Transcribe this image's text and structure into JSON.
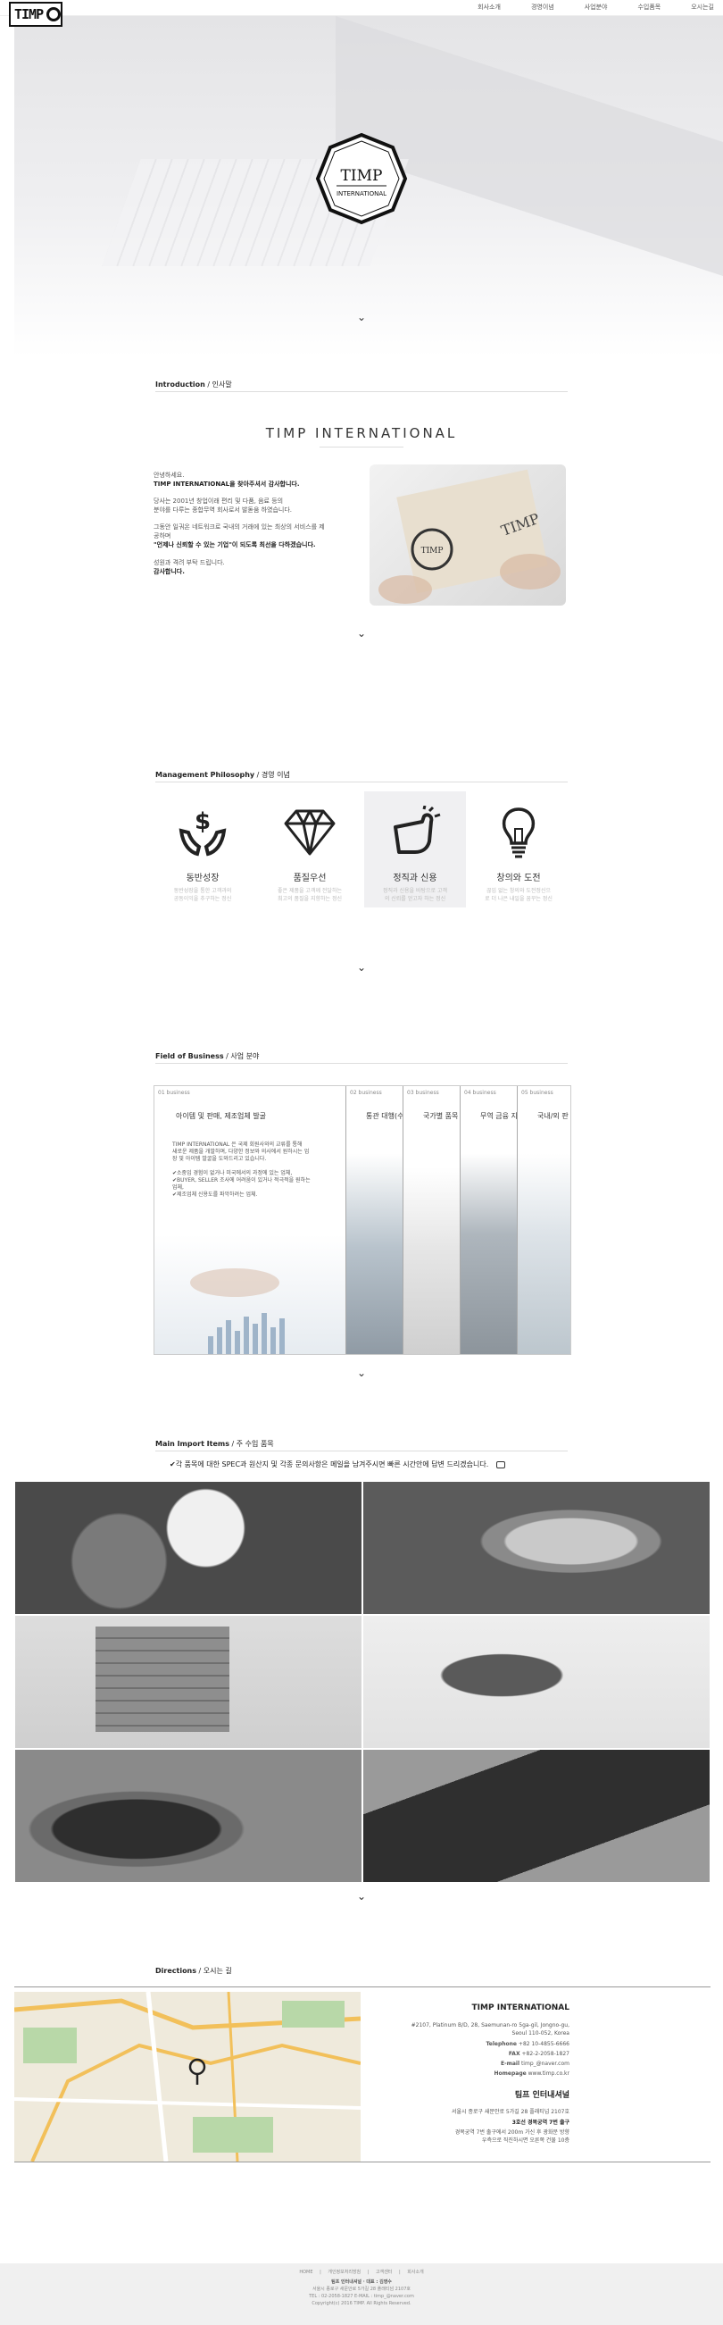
{
  "nav": {
    "logo": "TIMP",
    "items": [
      "회사소개",
      "경영이념",
      "사업분야",
      "수입품목",
      "오시는길"
    ]
  },
  "hero": {
    "emblem_title": "TIMP",
    "emblem_sub": "INTERNATIONAL"
  },
  "intro": {
    "title": "Introduction",
    "title_ko": " / 인사말",
    "brand": "TIMP INTERNATIONAL",
    "p1": "안녕하세요.",
    "p2": "TIMP INTERNATIONAL을 찾아주셔서 감사합니다.",
    "p3": "당사는 2001년 창업이래 편리 및 다품, 음료 등의",
    "p4": "분야를 다루는 종합무역 회사로서 발돋움 하였습니다.",
    "p5": "그동안 일궈온 네트워크로 국내의 거래에 있는 최상의 서비스를 제",
    "p6": "공하며",
    "p7": "\"언제나 신뢰할 수 있는 기업\"이 되도록 최선을 다하겠습니다.",
    "p8": "성원과 격려 부탁 드립니다.",
    "p9": "감사합니다."
  },
  "philosophy": {
    "title": "Management Philosophy",
    "title_ko": " / 경영 이념",
    "items": [
      {
        "name": "동반성장",
        "d1": "동반성장을 통한 고객과의",
        "d2": "공동이익을 추구하는 정신",
        "icon": "money-hands-icon"
      },
      {
        "name": "품질우선",
        "d1": "좋은 제품을 고객께 전달하는",
        "d2": "최고의 품질을 지향하는 정신",
        "icon": "diamond-icon"
      },
      {
        "name": "정직과 신용",
        "d1": "정직과 신용을 바탕으로 고객",
        "d2": "의 신뢰를 얻고자 하는 정신",
        "icon": "handshake-icon"
      },
      {
        "name": "창의와 도전",
        "d1": "끊임 없는 창의와 도전정신으",
        "d2": "로 더 나은 내일을 꿈꾸는 정신",
        "icon": "lightbulb-icon"
      }
    ]
  },
  "business": {
    "title": "Field of Business",
    "title_ko": " / 사업 분야",
    "panels": [
      {
        "num": "01 business",
        "head": "아이템 및 판매, 제조업체 발굴"
      },
      {
        "num": "02 business",
        "head": "통관 대행(수"
      },
      {
        "num": "03 business",
        "head": "국가별 품목"
      },
      {
        "num": "04 business",
        "head": "무역 금융 지"
      },
      {
        "num": "05 business",
        "head": "국내/외 판"
      }
    ],
    "b1": "TIMP INTERNATIONAL 은 국제 회원사와의 교류를 통해",
    "b2": "새로운 제품을 개발하며, 다양한 정보와 의사에서 원하시는 업",
    "b3": "장 및 아이템 발굴을 도와드리고 있습니다.",
    "c1": "✔소중임 경험이 없거나 미국에서의 과정에 있는 업체,",
    "c2": "✔BUYER, SELLER 조사에 어려움이 있거나 적극적을 원하는",
    "c3": "업체,",
    "c4": "✔제조업체 신용도를 파악하려는 업체."
  },
  "imports": {
    "title": "Main Import Items",
    "title_ko": " / 주 수입 품목",
    "notice": "✔각 품목에 대한 SPEC과 원산지 및 각종 문의사항은 메일을 남겨주시면 빠른 시간안에 답변 드리겠습니다."
  },
  "directions": {
    "title": "Directions",
    "title_ko": " / 오시는 길",
    "company": "TIMP INTERNATIONAL",
    "a1": "#2107, Platinum B/D, 28, Saemunan-ro 5ga-gil, Jongno-gu,",
    "a2": "Seoul 110-052, Korea",
    "tel_l": "Telephone",
    "tel": " +82 10-4855-6666",
    "fax_l": "FAX",
    "fax": " +82-2-2058-1827",
    "mail_l": "E-mail",
    "mail": " timp_@naver.com",
    "home_l": "Homepage",
    "home": " www.timp.co.kr",
    "company_ko": "팀프 인터내셔널",
    "k1": "서울시 종로구 새문안로 5가길 28 플래티넘 2107호",
    "k2": "3호선 경복궁역 7번 출구",
    "k3": "경복궁역 7번 출구에서 200m 가신 후 광화문 방향",
    "k4": "우측으로 직진하시면 오른쪽 건물 10층"
  },
  "footer": {
    "links": "HOME | 개인정보처리방침 | 고객센터 | 회사소개",
    "l1": "팀프 인터내셔널 · 대표 : 김영수",
    "l2": "서울시 종로구 새문안로 5가길 28 플래티넘 2107호",
    "l3": "TEL : 02-2058-1827 E-MAIL : timp_@naver.com",
    "l4": "Copyright(c) 2016 TIMP. All Rights Reserved."
  },
  "colors": {
    "accent": "#333333",
    "light": "#f0f0f2"
  }
}
